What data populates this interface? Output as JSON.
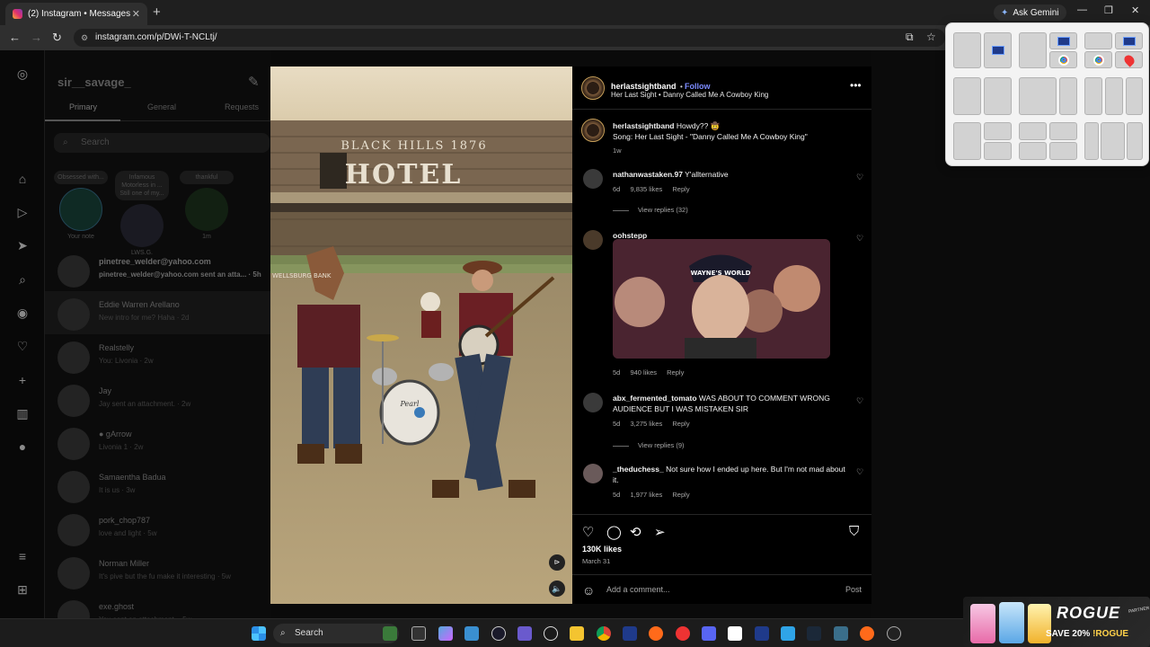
{
  "browser": {
    "tab_title": "(2) Instagram • Messages",
    "tab_close": "✕",
    "new_tab": "+",
    "url": "instagram.com/p/DWi-T-NCLtj/",
    "ask_gemini": "Ask Gemini",
    "minimize": "—",
    "restore": "❐",
    "close": "✕"
  },
  "dm": {
    "username": "sir__savage_",
    "tabs": [
      "Primary",
      "General",
      "Requests"
    ],
    "search_placeholder": "Search",
    "notes": [
      {
        "text": "Obsessed with...",
        "label": "Your note"
      },
      {
        "text": "Infamous Motorless in ... Still one of my...",
        "label": "LWS.G."
      },
      {
        "text": "thankful",
        "label": "1m"
      }
    ],
    "conversations": [
      {
        "name": "pinetree_welder@yahoo.com",
        "sub": "pinetree_welder@yahoo.com sent an atta... · 5h",
        "bold": true
      },
      {
        "name": "Eddie Warren Arellano",
        "sub": "New intro for me? Haha · 2d",
        "bold": false
      },
      {
        "name": "Realstelly",
        "sub": "You: Livonia · 2w",
        "bold": false
      },
      {
        "name": "Jay",
        "sub": "Jay sent an attachment. · 2w",
        "bold": false
      },
      {
        "name": "● gArrow",
        "sub": "Livonia 1 · 2w",
        "bold": false
      },
      {
        "name": "Samaentha Badua",
        "sub": "It is us · 3w",
        "bold": false
      },
      {
        "name": "pork_chop787",
        "sub": "love and light · 5w",
        "bold": false
      },
      {
        "name": "Norman Miller",
        "sub": "It's pive but the fu make it interesting · 5w",
        "bold": false
      },
      {
        "name": "exe.ghost",
        "sub": "You sent an attachment. · 5w",
        "bold": false
      }
    ]
  },
  "media": {
    "sign_top": "BLACK HILLS 1876",
    "sign_main": "HOTEL",
    "sign_side": "WELLSBURG BANK",
    "drum_brand": "Pearl"
  },
  "post": {
    "author": "herlastsightband",
    "follow": "Follow",
    "audio": "Her Last Sight • Danny Called Me A Cowboy King",
    "caption_user": "herlastsightband",
    "caption_text": "Howdy?? 🤠",
    "caption_song": "Song: Her Last Sight - \"Danny Called Me A Cowboy King\"",
    "caption_age": "1w",
    "comments": [
      {
        "user": "nathanwastaken.97",
        "text": "Y'allternative",
        "age": "6d",
        "likes": "9,835 likes",
        "reply": "Reply",
        "replies": "View replies (32)"
      },
      {
        "user": "oohstepp",
        "text": "",
        "age": "5d",
        "likes": "940 likes",
        "reply": "Reply",
        "gif_text": "WAYNE'S WORLD"
      },
      {
        "user": "abx_fermented_tomato",
        "text": "WAS ABOUT TO COMMENT WRONG AUDIENCE BUT I WAS MISTAKEN SIR",
        "age": "5d",
        "likes": "3,275 likes",
        "reply": "Reply",
        "replies": "View replies (9)"
      },
      {
        "user": "_theduchess_",
        "text": "Not sure how I ended up here. But I'm not mad about it.",
        "age": "5d",
        "likes": "1,977 likes",
        "reply": "Reply"
      }
    ],
    "total_likes": "130K likes",
    "date": "March 31",
    "comment_placeholder": "Add a comment...",
    "post_button": "Post"
  },
  "taskbar": {
    "search": "Search"
  },
  "ad": {
    "brand": "ROGUE",
    "partner": "PARTNER",
    "save_prefix": "SAVE 20% ",
    "save_code": "!ROGUE"
  },
  "colors": {
    "accent_follow": "#7c8cff",
    "background": "#000000",
    "snap_bg": "#f3f3f3"
  }
}
